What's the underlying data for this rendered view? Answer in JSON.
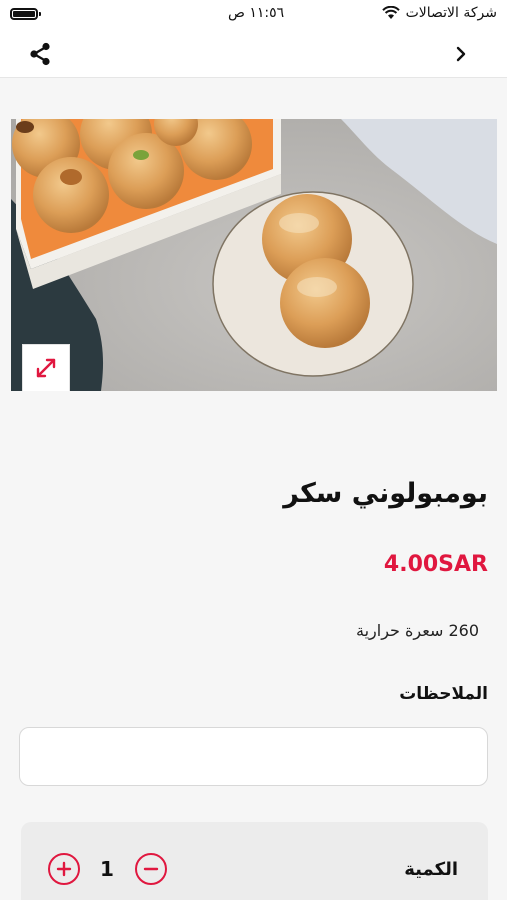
{
  "status_bar": {
    "carrier": "شركة الاتصالات",
    "time": "١١:٥٦ ص"
  },
  "nav": {
    "share_icon": "share-icon",
    "back_icon": "chevron-right-icon"
  },
  "product": {
    "image_alt": "بومبولوني سكر",
    "expand_icon": "expand-icon",
    "name": "بومبولوني سكر",
    "price": "4.00SAR",
    "calories": "260 سعرة حرارية"
  },
  "notes": {
    "label": "الملاحظات",
    "value": "",
    "placeholder": ""
  },
  "quantity": {
    "label": "الكمية",
    "value": "1",
    "plus_icon": "plus-circle-icon",
    "minus_icon": "minus-circle-icon"
  },
  "colors": {
    "accent": "#e0173f",
    "background": "#f6f6f6"
  }
}
